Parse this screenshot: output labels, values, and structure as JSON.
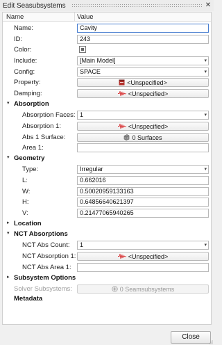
{
  "window": {
    "title": "Edit Seasubsystems",
    "close_glyph": "✕"
  },
  "columns": {
    "name": "Name",
    "value": "Value"
  },
  "general": {
    "name_label": "Name:",
    "name_value": "Cavity",
    "id_label": "ID:",
    "id_value": "243",
    "color_label": "Color:",
    "include_label": "Include:",
    "include_value": "[Main Model]",
    "config_label": "Config:",
    "config_value": "SPACE",
    "property_label": "Property:",
    "property_value": "<Unspecified>",
    "damping_label": "Damping:",
    "damping_value": "<Unspecified>"
  },
  "absorption": {
    "title": "Absorption",
    "expanded": true,
    "faces_label": "Absorption Faces:",
    "faces_value": "1",
    "abs1_label": "Absorption 1:",
    "abs1_value": "<Unspecified>",
    "surface_label": "Abs 1 Surface:",
    "surface_value": "0 Surfaces",
    "area_label": "Area 1:",
    "area_value": ""
  },
  "geometry": {
    "title": "Geometry",
    "expanded": true,
    "type_label": "Type:",
    "type_value": "Irregular",
    "l_label": "L:",
    "l_value": "0.662016",
    "w_label": "W:",
    "w_value": "0.50020959133163",
    "h_label": "H:",
    "h_value": "0.64856640621397",
    "v_label": "V:",
    "v_value": "0.21477065940265"
  },
  "location": {
    "title": "Location",
    "expanded": false
  },
  "nct": {
    "title": "NCT Absorptions",
    "expanded": true,
    "count_label": "NCT Abs Count:",
    "count_value": "1",
    "abs1_label": "NCT Absorption 1:",
    "abs1_value": "<Unspecified>",
    "area_label": "NCT Abs Area 1:",
    "area_value": ""
  },
  "subsystem_options": {
    "title": "Subsystem Options",
    "expanded": false,
    "solver_label": "Solver Subsystems:",
    "solver_value": "0 Seamsubsystems"
  },
  "metadata": {
    "title": "Metadata"
  },
  "footer": {
    "close_label": "Close"
  },
  "icons": {
    "expanded": "▾",
    "collapsed": "▸",
    "combo_arrow": "▾",
    "property": "property-icon",
    "damping": "damping-icon",
    "absorption": "absorption-icon",
    "surface": "surface-icon",
    "solver": "add-circle-icon"
  },
  "colors": {
    "accent": "#4a7fd0",
    "damping_red": "#d9383a",
    "property_red": "#b5332e"
  }
}
